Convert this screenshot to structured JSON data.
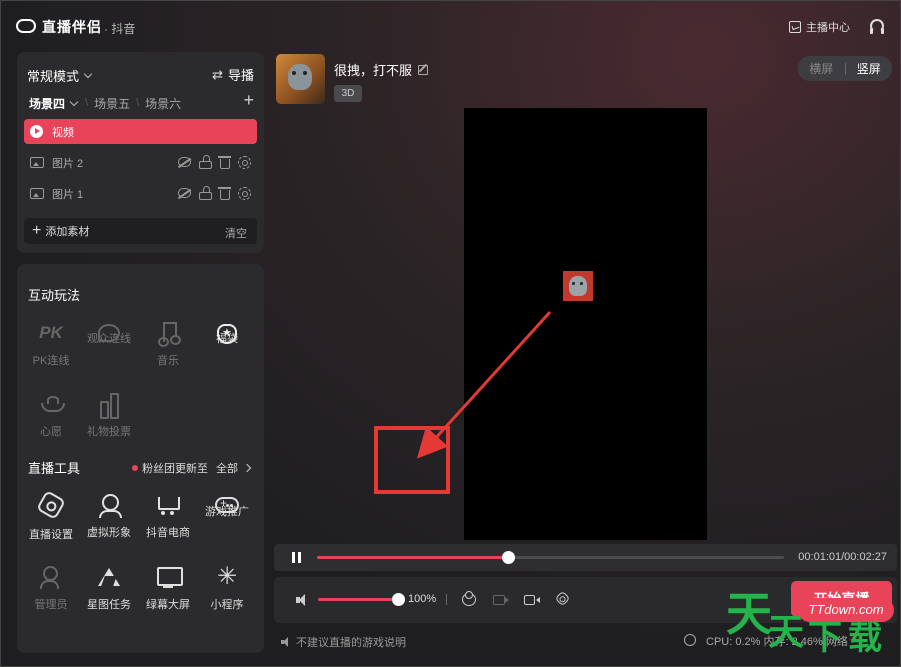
{
  "app": {
    "name": "直播伴侣",
    "platform": "· 抖音"
  },
  "header": {
    "host_center": "主播中心",
    "icon": "headset-icon"
  },
  "scene_panel": {
    "mode": "常规模式",
    "director": "导播",
    "tabs": [
      {
        "label": "场景四",
        "active": true
      },
      {
        "label": "场景五",
        "active": false
      },
      {
        "label": "场景六",
        "active": false
      }
    ],
    "add_scene": "+",
    "layers": [
      {
        "label": "视频",
        "active": true,
        "icon": "play-icon"
      },
      {
        "label": "图片 2",
        "active": false,
        "icon": "image-icon"
      },
      {
        "label": "图片 1",
        "active": false,
        "icon": "image-icon"
      }
    ],
    "add_material": "添加素材",
    "clear": "清空"
  },
  "interact_panel": {
    "title": "互动玩法",
    "items": [
      {
        "label": "PK连线",
        "icon": "pk-icon",
        "enabled": false
      },
      {
        "label": "观众连线",
        "icon": "audience-link-icon",
        "enabled": false
      },
      {
        "label": "音乐",
        "icon": "music-icon",
        "enabled": false
      },
      {
        "label": "福袋",
        "icon": "lucky-bag-icon",
        "enabled": true
      },
      {
        "label": "心愿",
        "icon": "wish-icon",
        "enabled": false
      },
      {
        "label": "礼物投票",
        "icon": "gift-vote-icon",
        "enabled": false
      }
    ],
    "pk_glyph": "PK",
    "tools_title": "直播工具",
    "fans_update": "粉丝团更新至",
    "all": "全部",
    "tools": [
      {
        "label": "直播设置",
        "icon": "live-settings-icon",
        "enabled": true
      },
      {
        "label": "虚拟形象",
        "icon": "avatar-icon",
        "enabled": true
      },
      {
        "label": "抖音电商",
        "icon": "cart-icon",
        "enabled": true
      },
      {
        "label": "游戏推广",
        "icon": "gamepad-icon",
        "enabled": true
      },
      {
        "label": "管理员",
        "icon": "admin-icon",
        "enabled": false
      },
      {
        "label": "星图任务",
        "icon": "task-icon",
        "enabled": true
      },
      {
        "label": "绿幕大屏",
        "icon": "green-screen-icon",
        "enabled": true
      },
      {
        "label": "小程序",
        "icon": "mini-program-icon",
        "enabled": true
      }
    ],
    "miniapp_glyph": "✳"
  },
  "game": {
    "title": "很拽，打不服",
    "badge": "3D"
  },
  "orientation": {
    "landscape": "横屏",
    "portrait": "竖屏",
    "active": "portrait"
  },
  "player": {
    "progress": 0.41,
    "time": "00:01:01/00:02:27"
  },
  "controls": {
    "volume": 1.0,
    "volume_label": "100%",
    "start_live": "开始直播"
  },
  "footer": {
    "note": "不建议直播的游戏说明",
    "perf": "CPU: 0.2%  内存: 2.46%  网络"
  },
  "watermark": {
    "chars": "天天下载",
    "url": "TTdown.com"
  },
  "colors": {
    "accent": "#e9435a",
    "panel": "#2b2b2e",
    "watermark_green": "#25b34b"
  }
}
